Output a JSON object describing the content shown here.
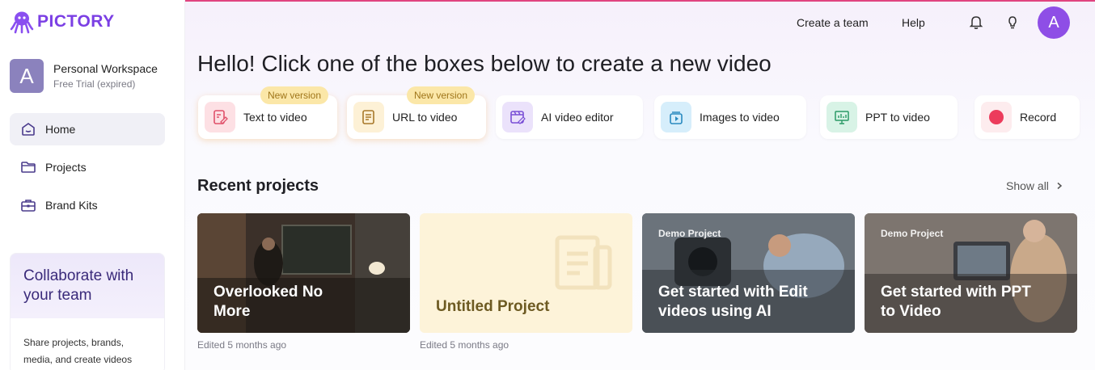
{
  "brand": {
    "name": "PICTORY",
    "color": "#7b3fe4"
  },
  "sidebar": {
    "workspace": {
      "avatar_letter": "A",
      "name": "Personal Workspace",
      "status": "Free Trial (expired)"
    },
    "items": [
      {
        "label": "Home",
        "icon": "home-icon"
      },
      {
        "label": "Projects",
        "icon": "folder-icon"
      },
      {
        "label": "Brand Kits",
        "icon": "briefcase-icon"
      }
    ],
    "collab": {
      "title": "Collaborate with your team",
      "body": "Share projects, brands, media, and create videos"
    }
  },
  "topbar": {
    "create_team": "Create a team",
    "help": "Help",
    "avatar_letter": "A"
  },
  "main": {
    "headline": "Hello! Click one of the boxes below to create a new video",
    "actions": [
      {
        "label": "Text to video",
        "badge": "New version",
        "icon": "text-to-video-icon"
      },
      {
        "label": "URL to video",
        "badge": "New version",
        "icon": "url-to-video-icon"
      },
      {
        "label": "AI video editor",
        "icon": "ai-editor-icon"
      },
      {
        "label": "Images to video",
        "icon": "images-to-video-icon"
      },
      {
        "label": "PPT to video",
        "icon": "ppt-to-video-icon"
      },
      {
        "label": "Record",
        "icon": "record-icon"
      }
    ],
    "recent_title": "Recent projects",
    "show_all": "Show all",
    "projects": [
      {
        "title": "Overlooked No More",
        "edited": "Edited 5 months ago"
      },
      {
        "title": "Untitled Project",
        "edited": "Edited 5 months ago"
      },
      {
        "tag": "Demo Project",
        "title": "Get started with Edit videos using AI"
      },
      {
        "tag": "Demo Project",
        "title": "Get started with PPT to Video"
      }
    ]
  }
}
